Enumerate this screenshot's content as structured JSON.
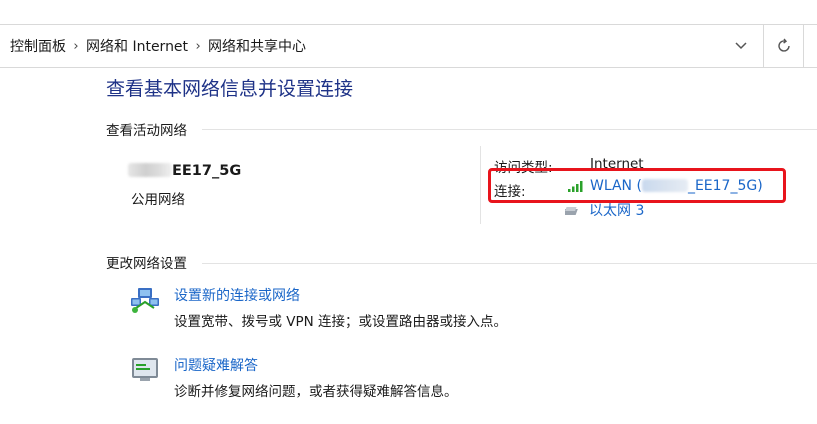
{
  "breadcrumb": [
    "控制面板",
    "网络和 Internet",
    "网络和共享中心"
  ],
  "page_title": "查看基本网络信息并设置连接",
  "active_networks": {
    "heading": "查看活动网络",
    "network_name": "EE17_5G",
    "network_category": "公用网络",
    "access_type_label": "访问类型:",
    "access_type_value": "Internet",
    "connections_label": "连接:",
    "wlan_link": "WLAN (",
    "wlan_link_tail": "_EE17_5G)",
    "ethernet_link": "以太网 3"
  },
  "change_settings": {
    "heading": "更改网络设置",
    "tasks": [
      {
        "title": "设置新的连接或网络",
        "description": "设置宽带、拨号或 VPN 连接；或设置路由器或接入点。"
      },
      {
        "title": "问题疑难解答",
        "description": "诊断并修复网络问题，或者获得疑难解答信息。"
      }
    ]
  },
  "icons": {
    "dropdown": "chevron-down-icon",
    "refresh": "refresh-icon",
    "wifi_signal": "wifi-signal-icon",
    "ethernet": "ethernet-icon",
    "new_connection": "network-setup-icon",
    "troubleshoot": "troubleshoot-icon"
  },
  "colors": {
    "link": "#1a66c8",
    "title": "#1e3287",
    "highlight": "#e8141c"
  }
}
